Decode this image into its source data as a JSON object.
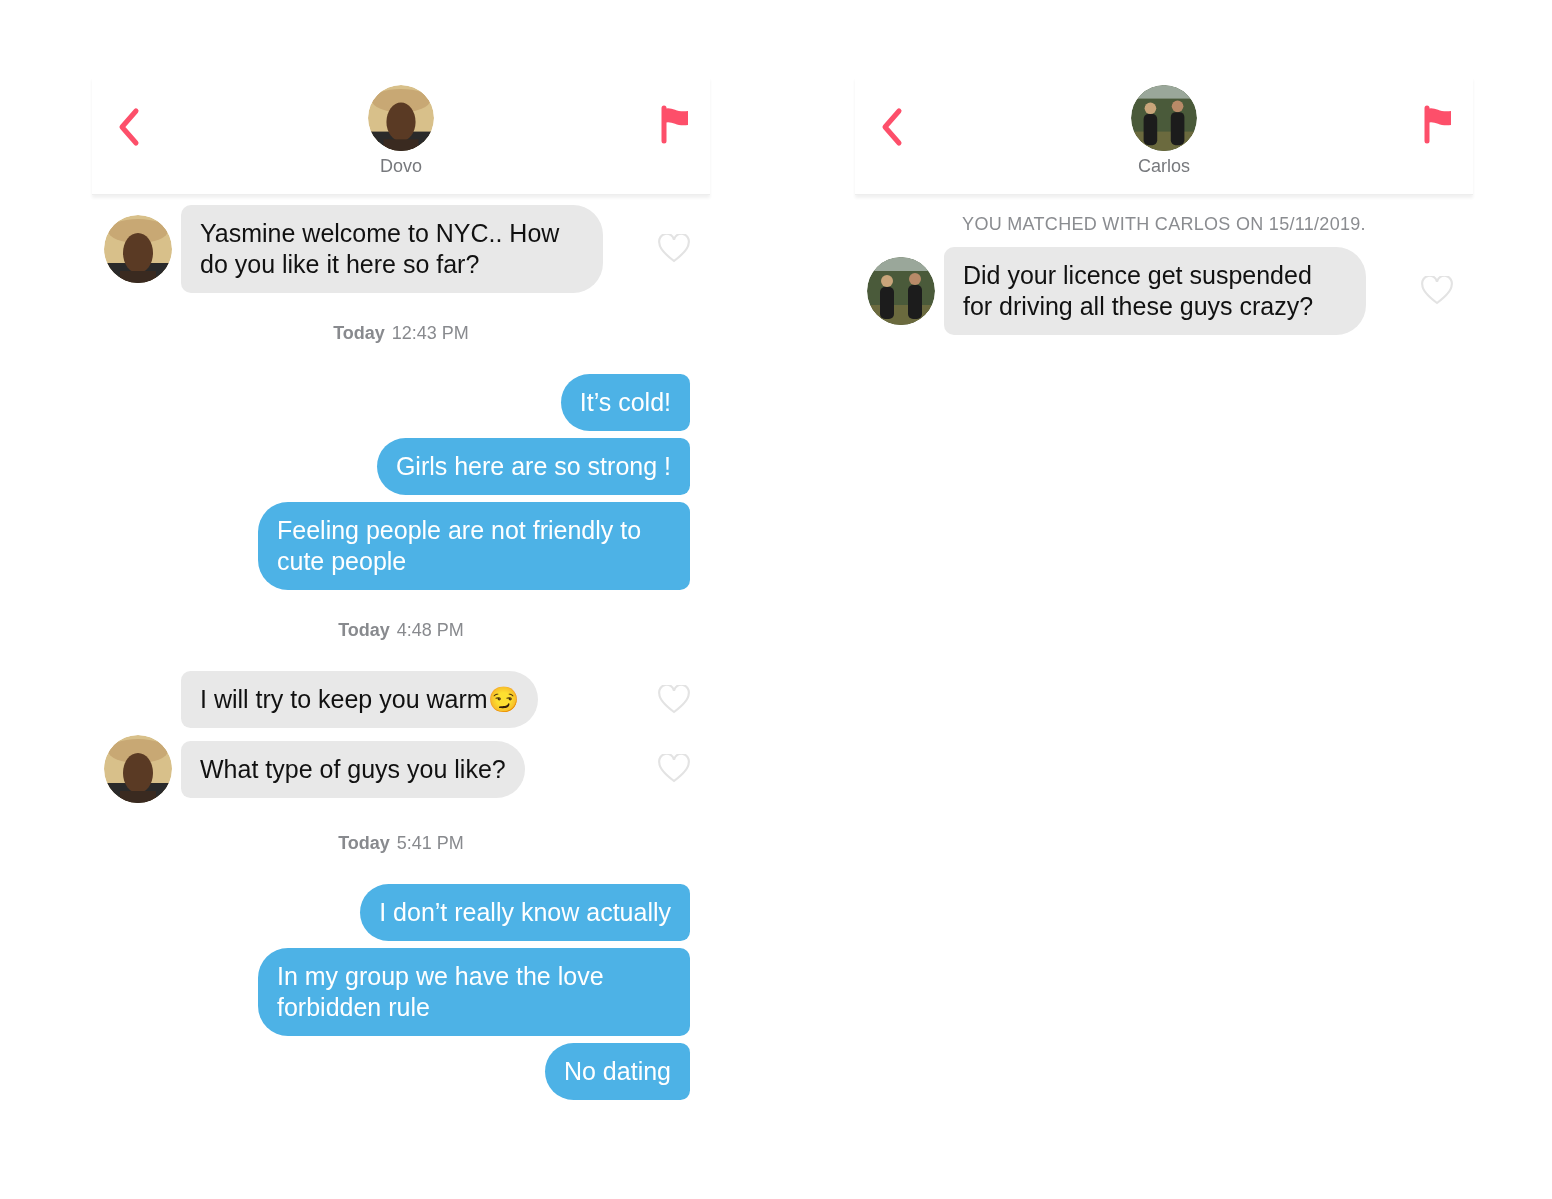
{
  "panels": [
    {
      "contact": {
        "name": "Dovo"
      },
      "messages": [
        {
          "kind": "received",
          "text": "Yasmine welcome to NYC.. How do you like it here so far?",
          "avatar": true,
          "liked": false
        },
        {
          "kind": "timestamp",
          "day": "Today",
          "time": "12:43 PM"
        },
        {
          "kind": "sent",
          "text": "It’s cold!"
        },
        {
          "kind": "sent",
          "text": "Girls here are so strong !"
        },
        {
          "kind": "sent",
          "text": "Feeling people are not friendly to cute people"
        },
        {
          "kind": "timestamp",
          "day": "Today",
          "time": "4:48 PM"
        },
        {
          "kind": "received",
          "text": "I will try to keep you warm😏",
          "avatar": false,
          "liked": false
        },
        {
          "kind": "received",
          "text": "What type of guys you like?",
          "avatar": true,
          "liked": false
        },
        {
          "kind": "timestamp",
          "day": "Today",
          "time": "5:41 PM"
        },
        {
          "kind": "sent",
          "text": "I don’t really know actually"
        },
        {
          "kind": "sent",
          "text": "In my group we have the love forbidden rule"
        },
        {
          "kind": "sent",
          "text": "No dating"
        }
      ]
    },
    {
      "contact": {
        "name": "Carlos"
      },
      "messages": [
        {
          "kind": "match_note",
          "text": "YOU MATCHED WITH CARLOS ON 15/11/2019."
        },
        {
          "kind": "received",
          "text": "Did your licence get suspended for driving all these guys crazy?",
          "avatar": true,
          "liked": false
        }
      ]
    }
  ]
}
